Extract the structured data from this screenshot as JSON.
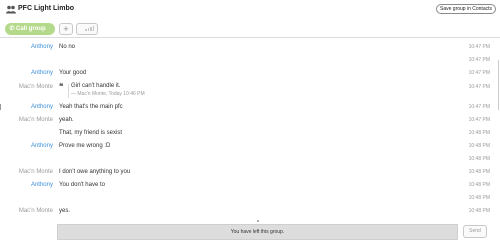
{
  "header": {
    "title": "PFC Light Limbo",
    "save_button": "Save group in Contacts",
    "icon": "group-icon"
  },
  "toolbar": {
    "call_label": "Call group",
    "call_icon": "phone-icon",
    "add_label": "+",
    "signal_icon": "signal-bars-icon",
    "call_color": "#b5d98a"
  },
  "messages": [
    {
      "sender": "Anthony",
      "text": "No no",
      "time": "10:47 PM"
    },
    {
      "sender": "",
      "text": "",
      "time": "10:47 PM"
    },
    {
      "sender": "Anthony",
      "text": "Your good",
      "time": "10:47 PM"
    },
    {
      "sender": "Mac'n Monte",
      "quote_text": "Girl can't handle it.",
      "quote_cite": "— Mac'n Monte, Today 10:46 PM",
      "time": "10:47 PM"
    },
    {
      "sender": "Anthony",
      "text": "Yeah that's the main pfc",
      "time": "10:47 PM"
    },
    {
      "sender": "Mac'n Monte",
      "text": "yeah.",
      "time": "10:47 PM"
    },
    {
      "sender": "",
      "text": "That, my friend is sexist",
      "time": "10:48 PM"
    },
    {
      "sender": "Anthony",
      "text": "Prove me wrong :D",
      "time": "10:48 PM"
    },
    {
      "sender": "",
      "text": "",
      "time": "10:48 PM"
    },
    {
      "sender": "Mac'n Monte",
      "text": "I don't owe anything to you",
      "time": "10:48 PM"
    },
    {
      "sender": "Anthony",
      "text": "You don't have to",
      "time": "10:48 PM"
    },
    {
      "sender": "",
      "text": "",
      "time": "10:48 PM"
    },
    {
      "sender": "Mac'n Monte",
      "text": "yes.",
      "time": "10:48 PM"
    }
  ],
  "footer": {
    "status_text": "You have left this group.",
    "send_label": "Send"
  },
  "colors": {
    "sender_link": "#3b8fd6",
    "sender_other": "#9a9a9a",
    "banner_bg": "#dddddd"
  }
}
